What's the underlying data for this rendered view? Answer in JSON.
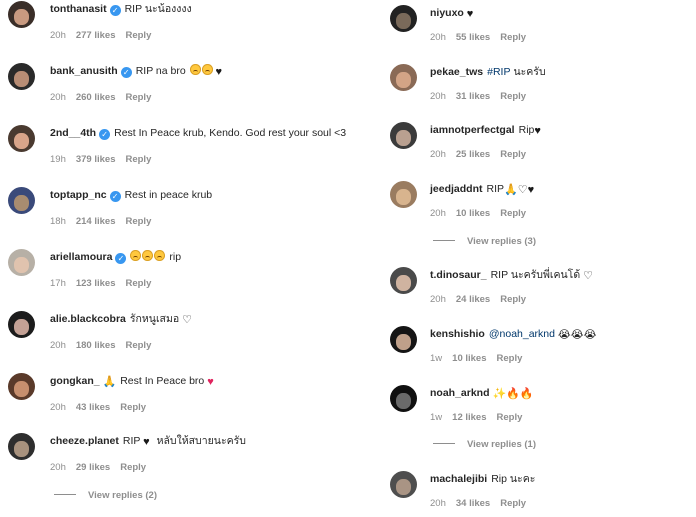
{
  "left": [
    {
      "username": "tonthanasit",
      "verified": true,
      "text": "RIP นะน้องงงง",
      "time": "20h",
      "likes": "277 likes",
      "reply": "Reply",
      "avatar_colors": [
        "#3a2e28",
        "#c99a80"
      ]
    },
    {
      "username": "bank_anusith",
      "verified": true,
      "text": "RIP na bro",
      "time": "20h",
      "likes": "260 likes",
      "reply": "Reply",
      "avatar_colors": [
        "#2a2a2a",
        "#b88d75"
      ]
    },
    {
      "username": "2nd__4th",
      "verified": true,
      "text": "Rest In Peace krub, Kendo. God rest your soul <3",
      "time": "19h",
      "likes": "379 likes",
      "reply": "Reply",
      "avatar_colors": [
        "#4a3a30",
        "#d9a58a"
      ]
    },
    {
      "username": "toptapp_nc",
      "verified": true,
      "text": "Rest in peace krub",
      "time": "18h",
      "likes": "214 likes",
      "reply": "Reply",
      "avatar_colors": [
        "#3a4a7a",
        "#a88c70"
      ]
    },
    {
      "username": "ariellamoura",
      "verified": true,
      "text": "rip",
      "time": "17h",
      "likes": "123 likes",
      "reply": "Reply",
      "avatar_colors": [
        "#b7b0a6",
        "#e0c3ae"
      ]
    },
    {
      "username": "alie.blackcobra",
      "verified": false,
      "text": "รักหนูเสมอ",
      "time": "20h",
      "likes": "180 likes",
      "reply": "Reply",
      "avatar_colors": [
        "#1c1c1c",
        "#c4a195"
      ]
    },
    {
      "username": "gongkan_",
      "verified": false,
      "text": "Rest In Peace bro",
      "time": "20h",
      "likes": "43 likes",
      "reply": "Reply",
      "avatar_colors": [
        "#5a3a2a",
        "#c78f6e"
      ]
    },
    {
      "username": "cheeze.planet",
      "verified": false,
      "text": "RIP",
      "text2": "หลับให้สบายนะครับ",
      "time": "20h",
      "likes": "29 likes",
      "reply": "Reply",
      "avatar_colors": [
        "#2e2e2e",
        "#a8927e"
      ]
    }
  ],
  "left_view_replies": "View replies (2)",
  "right": [
    {
      "username": "niyuxo",
      "text": "",
      "time": "20h",
      "likes": "55 likes",
      "reply": "Reply",
      "avatar_colors": [
        "#222222",
        "#7a6a5a"
      ]
    },
    {
      "username": "pekae_tws",
      "text": "",
      "tag": "#RIP",
      "text_after": "นะครับ",
      "time": "20h",
      "likes": "31 likes",
      "reply": "Reply",
      "avatar_colors": [
        "#8a6a56",
        "#d3a486"
      ]
    },
    {
      "username": "iamnotperfectgal",
      "text": "Rip",
      "time": "20h",
      "likes": "25 likes",
      "reply": "Reply",
      "avatar_colors": [
        "#3b3b3b",
        "#b9a090"
      ]
    },
    {
      "username": "jeedjaddnt",
      "text": "RIP",
      "time": "20h",
      "likes": "10 likes",
      "reply": "Reply",
      "avatar_colors": [
        "#9a7c60",
        "#d8b48e"
      ]
    },
    {
      "username": "t.dinosaur_",
      "text": "RIP นะครับพี่เคนโด้",
      "time": "20h",
      "likes": "24 likes",
      "reply": "Reply",
      "avatar_colors": [
        "#4a4a4a",
        "#cfb3a0"
      ]
    },
    {
      "username": "kenshishio",
      "text": "",
      "tag": "@noah_arknd",
      "time": "1w",
      "likes": "10 likes",
      "reply": "Reply",
      "avatar_colors": [
        "#151515",
        "#bfa08a"
      ]
    },
    {
      "username": "noah_arknd",
      "text": "",
      "time": "1w",
      "likes": "12 likes",
      "reply": "Reply",
      "avatar_colors": [
        "#101010",
        "#6a6a6a"
      ]
    },
    {
      "username": "machalejibi",
      "text": "Rip นะคะ",
      "time": "20h",
      "likes": "34 likes",
      "reply": "Reply",
      "avatar_colors": [
        "#4e4e4e",
        "#a99484"
      ]
    }
  ],
  "right_view_replies": [
    "View replies (3)",
    "View replies (1)"
  ],
  "colors": {
    "verified": "#3897f0",
    "meta": "#8e8e8e",
    "link": "#00376b",
    "heart_red": "#e0245e"
  }
}
